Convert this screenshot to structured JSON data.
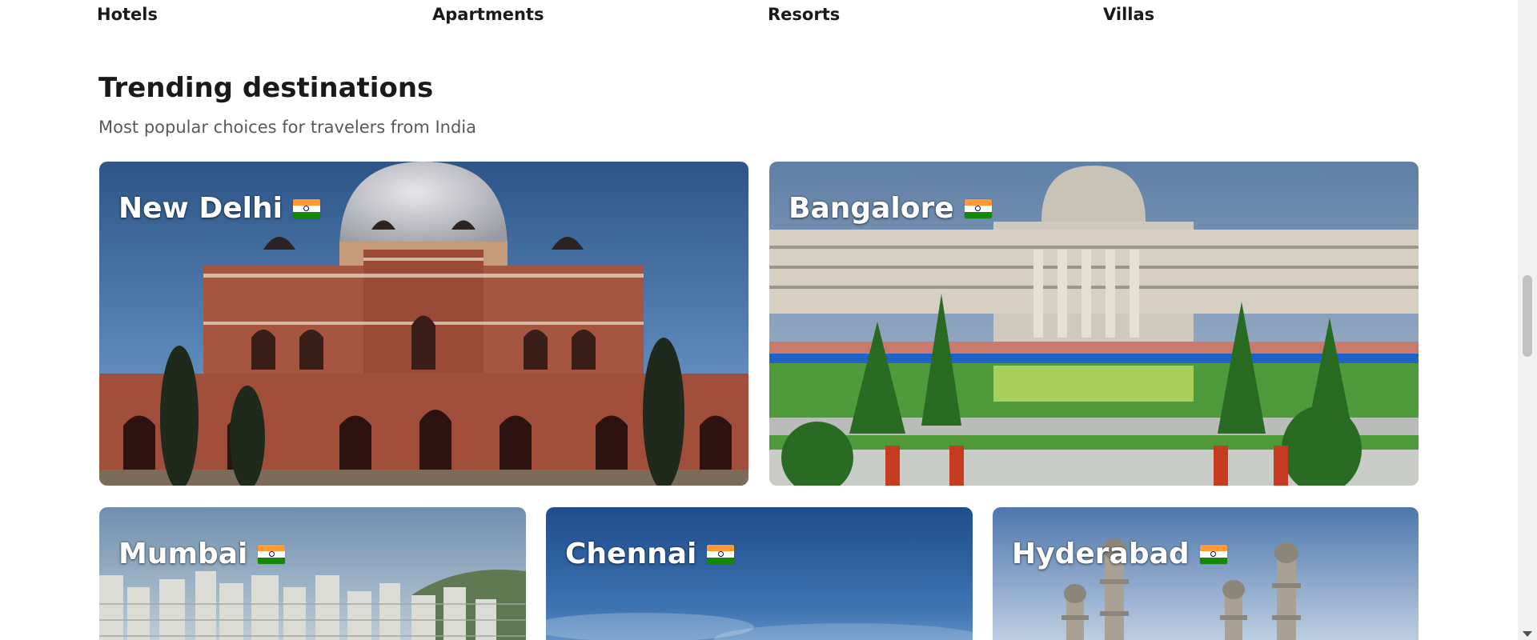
{
  "property_types": [
    {
      "label": "Hotels"
    },
    {
      "label": "Apartments"
    },
    {
      "label": "Resorts"
    },
    {
      "label": "Villas"
    }
  ],
  "trending": {
    "title": "Trending destinations",
    "subtitle": "Most popular choices for travelers from India"
  },
  "destinations": [
    {
      "name": "New Delhi",
      "flag_icon": "india-flag-icon"
    },
    {
      "name": "Bangalore",
      "flag_icon": "india-flag-icon"
    },
    {
      "name": "Mumbai",
      "flag_icon": "india-flag-icon"
    },
    {
      "name": "Chennai",
      "flag_icon": "india-flag-icon"
    },
    {
      "name": "Hyderabad",
      "flag_icon": "india-flag-icon"
    }
  ],
  "colors": {
    "flag_saffron": "#ff9933",
    "flag_white": "#ffffff",
    "flag_green": "#138808",
    "heading_text": "#1a1a1a",
    "subtitle_text": "#595959"
  }
}
